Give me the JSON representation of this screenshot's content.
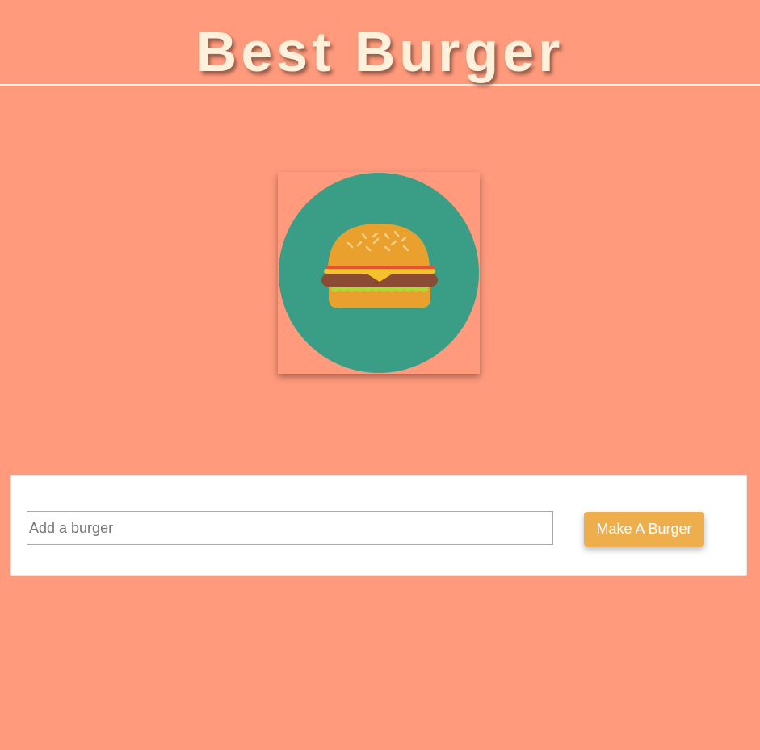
{
  "header": {
    "title": "Best Burger"
  },
  "logo": {
    "icon": "burger-icon",
    "circle_color": "#3A9D86",
    "bun_color": "#EAA02D",
    "patty_color": "#8C4B33",
    "cheese_color": "#F6C12F",
    "lettuce_color": "#AFD73D"
  },
  "form": {
    "input_placeholder": "Add a burger",
    "input_value": "",
    "submit_label": "Make A Burger"
  },
  "colors": {
    "background": "#FF9A7C",
    "title_text": "#FDF1DC",
    "button": "#EDAE4B"
  }
}
